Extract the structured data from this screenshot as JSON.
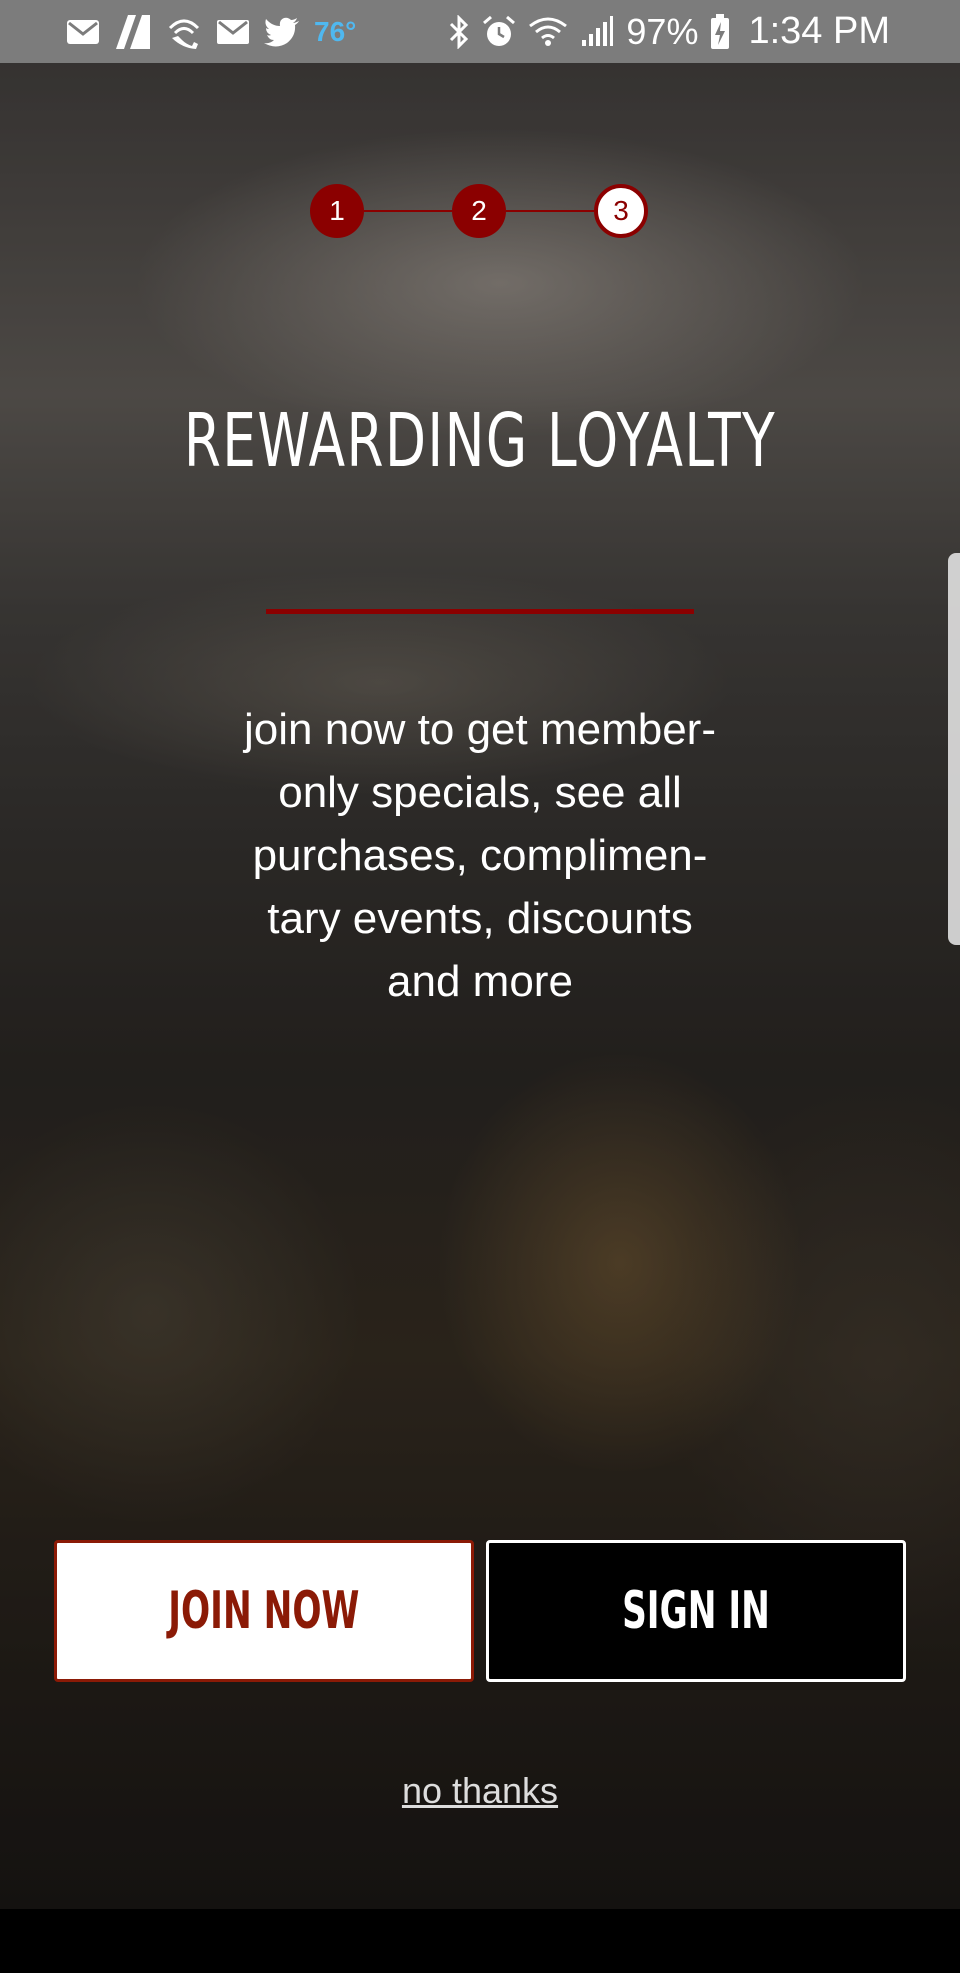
{
  "status_bar": {
    "temperature": "76°",
    "battery": "97%",
    "time": "1:34 PM",
    "left_icons": [
      "mail-icon",
      "flipboard-icon",
      "wifi-calling-icon",
      "gmail-icon",
      "twitter-icon"
    ],
    "right_icons": [
      "bluetooth-icon",
      "alarm-icon",
      "wifi-icon",
      "signal-icon",
      "battery-charging-icon"
    ]
  },
  "stepper": {
    "steps": [
      "1",
      "2",
      "3"
    ],
    "active_step": 3
  },
  "onboarding": {
    "title": "REWARDING LOYALTY",
    "description_lines": [
      "join now to get member-",
      "only specials, see all",
      "purchases, complimen-",
      "tary events, discounts",
      "and more"
    ]
  },
  "actions": {
    "join_label": "JOIN NOW",
    "signin_label": "SIGN IN",
    "skip_label": "no thanks"
  },
  "colors": {
    "accent": "#8b0000",
    "join_text": "#8b1a06",
    "status_bar": "#7c7c7c",
    "temperature": "#4fb8f0"
  }
}
